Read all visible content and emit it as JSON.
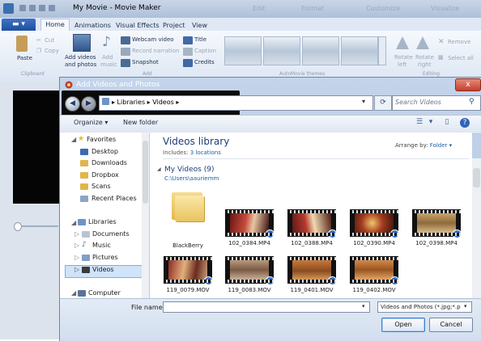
{
  "app": {
    "title": "My Movie - Movie Maker",
    "file_button": "",
    "tabs": [
      "Home",
      "Animations",
      "Visual Effects",
      "Project",
      "View"
    ],
    "titlebar_faint": [
      "Edit",
      "Format",
      "Customize",
      "Visualize"
    ]
  },
  "ribbon": {
    "clipboard": {
      "paste": "Paste",
      "cut": "Cut",
      "copy": "Copy",
      "label": "Clipboard"
    },
    "add": {
      "add_videos_line1": "Add videos",
      "add_videos_line2": "and photos",
      "add_music_line1": "Add",
      "add_music_line2": "music",
      "webcam": "Webcam video",
      "record": "Record narration",
      "snapshot": "Snapshot",
      "title": "Title",
      "caption": "Caption",
      "credits": "Credits",
      "label": "Add"
    },
    "themes_label": "AutoMovie themes",
    "editing": {
      "rotate_left_1": "Rotate",
      "rotate_left_2": "left",
      "rotate_right_1": "Rotate",
      "rotate_right_2": "right",
      "remove": "Remove",
      "select_all": "Select all",
      "label": "Editing"
    }
  },
  "dialog": {
    "title": "Add Videos and Photos",
    "close": "x",
    "breadcrumb": "▸ Libraries ▸ Videos ▸",
    "search_placeholder": "Search Videos",
    "toolbar": {
      "organize": "Organize ▾",
      "new_folder": "New folder"
    },
    "nav": {
      "favorites": "Favorites",
      "favorites_items": [
        "Desktop",
        "Downloads",
        "Dropbox",
        "Scans",
        "Recent Places"
      ],
      "libraries": "Libraries",
      "libraries_items": [
        "Documents",
        "Music",
        "Pictures",
        "Videos"
      ],
      "computer": "Computer"
    },
    "library_title": "Videos library",
    "library_sub_prefix": "Includes:",
    "library_sub_link": "3 locations",
    "arrange_label": "Arrange by:",
    "arrange_value": "Folder ▾",
    "group_title": "My Videos (9)",
    "group_path": "C:\\Users\\aauriemm",
    "files": [
      "BlackBerry",
      "102_0384.MP4",
      "102_0388.MP4",
      "102_0390.MP4",
      "102_0398.MP4",
      "119_0079.MOV",
      "119_0083.MOV",
      "119_0401.MOV",
      "119_0402.MOV"
    ],
    "file_name_label": "File name:",
    "file_name_value": "",
    "filter": "Videos and Photos (*.jpg;*.p",
    "open": "Open",
    "cancel": "Cancel"
  },
  "colors": {
    "accent": "#1e3d78",
    "link": "#1f5ca8",
    "selection": "#cfe3fb"
  }
}
